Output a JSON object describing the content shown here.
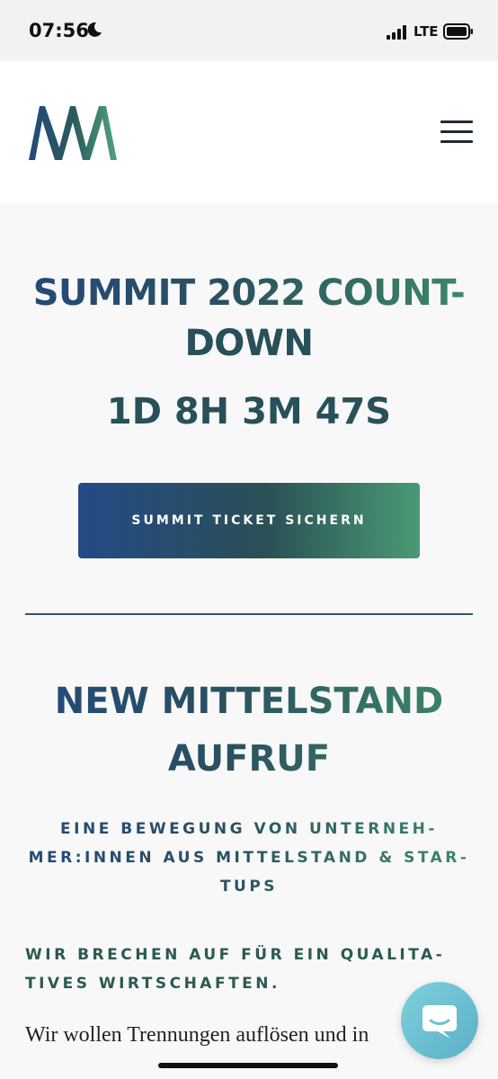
{
  "status_bar": {
    "time": "07:56",
    "network": "LTE",
    "icons": [
      "moon-icon",
      "signal-icon",
      "battery-icon"
    ]
  },
  "header": {
    "logo_alt": "NM",
    "menu_icon": "hamburger-menu-icon"
  },
  "countdown": {
    "title_line1": "SUMMIT 2022 COUNT-",
    "title_line2": "DOWN",
    "timer": "1D 8H 3M 47S"
  },
  "cta": {
    "ticket_label": "SUMMIT TICKET SICHERN"
  },
  "aufruf": {
    "title_line1": "NEW MITTELSTAND",
    "title_line2": "AUFRUF",
    "subtitle_line1": "EINE BEWEGUNG VON UNTERNEH-",
    "subtitle_line2": "MER:INNEN AUS MITTELSTAND & STAR-",
    "subtitle_line3": "TUPS",
    "heading_line1": "WIR BRECHEN AUF FÜR EIN QUALITA-",
    "heading_line2": "TIVES WIRTSCHAFTEN.",
    "body": "Wir wollen Trennungen auflösen und in"
  },
  "chat": {
    "icon": "chat-bubble-icon"
  },
  "colors": {
    "brand_blue": "#24497a",
    "brand_green": "#3e8a6a",
    "chat_teal": "#6cc3d3"
  }
}
